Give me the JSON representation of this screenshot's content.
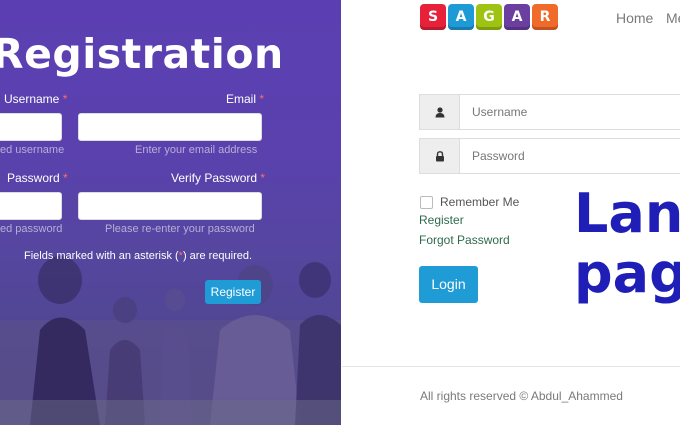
{
  "registration": {
    "title": "Registration",
    "username_label": "Username",
    "email_label": "Email",
    "password_label": "Password",
    "verify_password_label": "Verify Password",
    "required_marker": "*",
    "username_hint": "ed username",
    "email_hint": "Enter your email address",
    "password_hint": "ed password",
    "verify_password_hint": "Please re-enter your password",
    "note_before": "Fields marked with an asterisk (",
    "note_star": "*",
    "note_after": ") are required.",
    "register_button": "Register"
  },
  "logo": {
    "letters": [
      "S",
      "A",
      "G",
      "A",
      "R"
    ],
    "colors": [
      "#e8213a",
      "#1e9ad6",
      "#9ec312",
      "#6b3fa0",
      "#f06a2a"
    ]
  },
  "nav": {
    "home": "Home",
    "more": "Me"
  },
  "login": {
    "username_placeholder": "Username",
    "password_placeholder": "Password",
    "remember_me": "Remember Me",
    "register_link": "Register",
    "forgot_password_link": "Forgot Password",
    "login_button": "Login",
    "user_icon": "user-icon",
    "lock_icon": "lock-icon"
  },
  "promo": {
    "line1": "Lan",
    "line2": "pag"
  },
  "footer": {
    "text": "All rights reserved © Abdul_Ahammed"
  },
  "colors": {
    "accent": "#1f9bd6",
    "panel": "#5b3fb2",
    "promo": "#1f1fb8",
    "link": "#2f6a4c"
  }
}
